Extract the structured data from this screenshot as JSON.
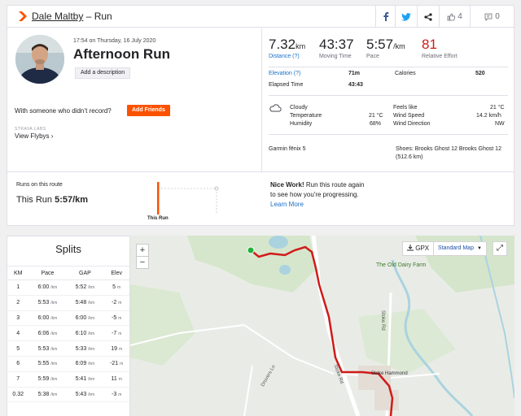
{
  "header": {
    "athlete_name": "Dale Maltby",
    "separator": " – ",
    "activity_type": "Run",
    "kudos_count": "4",
    "comment_count": "0"
  },
  "activity": {
    "timestamp": "17:54 on Thursday, 16 July 2020",
    "title": "Afternoon Run",
    "add_description": "Add a description",
    "with_someone": "With someone who didn’t record?",
    "add_friends": "Add Friends",
    "labs": "STRAVA LABS",
    "view_flybys": "View Flybys ›"
  },
  "stats": {
    "distance_value": "7.32",
    "distance_unit": "km",
    "distance_label": "Distance (?)",
    "moving_time_value": "43:37",
    "moving_time_label": "Moving Time",
    "pace_value": "5:57",
    "pace_unit": "/km",
    "pace_label": "Pace",
    "effort_value": "81",
    "effort_label": "Relative Effort"
  },
  "details": {
    "elevation_label": "Elevation (?)",
    "elevation_value": "71m",
    "calories_label": "Calories",
    "calories_value": "520",
    "elapsed_label": "Elapsed Time",
    "elapsed_value": "43:43"
  },
  "weather": {
    "condition": "Cloudy",
    "temperature_label": "Temperature",
    "temperature_value": "21 °C",
    "humidity_label": "Humidity",
    "humidity_value": "68%",
    "feels_like_label": "Feels like",
    "feels_like_value": "21 °C",
    "wind_speed_label": "Wind Speed",
    "wind_speed_value": "14.2 km/h",
    "wind_direction_label": "Wind Direction",
    "wind_direction_value": "NW"
  },
  "gear": {
    "device": "Garmin fēnix 5",
    "shoes_line1": "Shoes: Brooks Ghost 12 Brooks Ghost 12",
    "shoes_line2": "(512.6 km)"
  },
  "route": {
    "runs_on_route": "Runs on this route",
    "this_run_label": "This Run",
    "this_run_pace": "5:57/km",
    "chart_label": "This Run",
    "nice_work_bold": "Nice Work!",
    "nice_work_text1": " Run this route again",
    "nice_work_text2": "to see how you're progressing.",
    "learn_more": "Learn More"
  },
  "splits": {
    "title": "Splits",
    "columns": [
      "KM",
      "Pace",
      "GAP",
      "Elev"
    ],
    "unit": "/km",
    "elev_unit": "m",
    "rows": [
      {
        "km": "1",
        "pace": "6:00",
        "gap": "5:52",
        "elev": "5"
      },
      {
        "km": "2",
        "pace": "5:53",
        "gap": "5:48",
        "elev": "-2"
      },
      {
        "km": "3",
        "pace": "6:00",
        "gap": "6:00",
        "elev": "-5"
      },
      {
        "km": "4",
        "pace": "6:06",
        "gap": "6:10",
        "elev": "-7"
      },
      {
        "km": "5",
        "pace": "5:53",
        "gap": "5:33",
        "elev": "19"
      },
      {
        "km": "6",
        "pace": "5:55",
        "gap": "6:09",
        "elev": "-21"
      },
      {
        "km": "7",
        "pace": "5:59",
        "gap": "5:41",
        "elev": "11"
      },
      {
        "km": "0.32",
        "pace": "5:38",
        "gap": "5:43",
        "elev": "-3"
      }
    ]
  },
  "map": {
    "zoom_in": "+",
    "zoom_out": "−",
    "gpx": "GPX",
    "map_type": "Standard Map",
    "label_farm": "The Old Dairy Farm",
    "label_stoke_road": "Stoke Rd",
    "label_village": "Stoke Hammond",
    "label_drove": "Drovers Ln",
    "label_road_lower": "Stoke Rd"
  },
  "colors": {
    "brand": "#fc5200",
    "route_line": "#d11a1a",
    "link": "#1b6fc7"
  }
}
